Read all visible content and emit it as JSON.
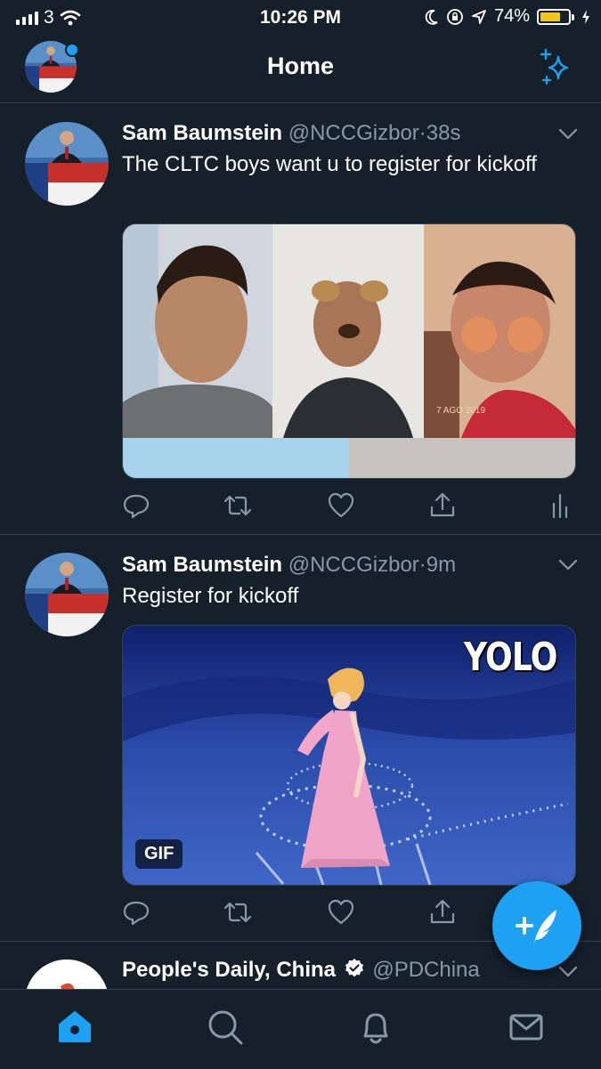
{
  "status_bar": {
    "carrier": "3",
    "time": "10:26 PM",
    "battery": "74%",
    "battery_level": 0.74,
    "icons": [
      "signal-icon",
      "wifi-icon",
      "moon-icon",
      "orientation-lock-icon",
      "location-icon",
      "battery-icon",
      "charging-icon"
    ]
  },
  "header": {
    "title": "Home",
    "icons": [
      "profile-avatar",
      "sparkle-icon"
    ]
  },
  "tweets": [
    {
      "name": "Sam Baumstein",
      "handle": "@NCCGizbor",
      "separator": "·",
      "time": "38s",
      "text": "The CLTC boys want u to register for kickoff",
      "media_type": "photo",
      "media_caption": "7 AGO 2019",
      "actions": [
        "reply-icon",
        "retweet-icon",
        "like-icon",
        "share-icon",
        "analytics-icon"
      ]
    },
    {
      "name": "Sam Baumstein",
      "handle": "@NCCGizbor",
      "separator": "·",
      "time": "9m",
      "text": "Register for kickoff",
      "media_type": "gif",
      "media_overlay": "YOLO",
      "media_badge": "GIF",
      "actions": [
        "reply-icon",
        "retweet-icon",
        "like-icon",
        "share-icon"
      ]
    },
    {
      "name": "People's Daily, China",
      "handle": "@PDChina",
      "verified": true
    }
  ],
  "fab": {
    "icon": "compose-tweet-icon"
  },
  "tab_bar": {
    "tabs": [
      "home-icon",
      "search-icon",
      "notifications-icon",
      "messages-icon"
    ],
    "active": "home-icon"
  },
  "colors": {
    "background": "#15202b",
    "accent": "#1da1f2",
    "secondary_text": "#8899a6",
    "divider": "#38444d"
  }
}
